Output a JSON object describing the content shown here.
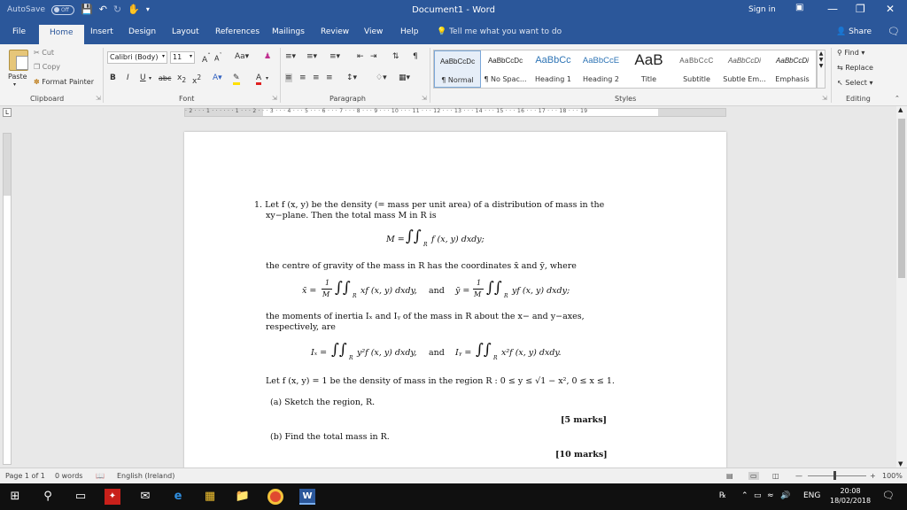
{
  "titlebar": {
    "autosave": "AutoSave",
    "toggle_state": "Off",
    "document_title": "Document1  -  Word",
    "signin": "Sign in"
  },
  "tabs": [
    "File",
    "Home",
    "Insert",
    "Design",
    "Layout",
    "References",
    "Mailings",
    "Review",
    "View",
    "Help"
  ],
  "tellme_placeholder": "Tell me what you want to do",
  "share": "Share",
  "ribbon": {
    "clipboard": {
      "paste": "Paste",
      "cut": "Cut",
      "copy": "Copy",
      "format_painter": "Format Painter",
      "label": "Clipboard"
    },
    "font": {
      "family": "Calibri (Body)",
      "size": "11",
      "label": "Font"
    },
    "paragraph": {
      "label": "Paragraph"
    },
    "styles": {
      "label": "Styles",
      "items": [
        {
          "sample": "AaBbCcDc",
          "name": "¶ Normal"
        },
        {
          "sample": "AaBbCcDc",
          "name": "¶ No Spac..."
        },
        {
          "sample": "AaBbCc",
          "name": "Heading 1"
        },
        {
          "sample": "AaBbCcE",
          "name": "Heading 2"
        },
        {
          "sample": "AaB",
          "name": "Title"
        },
        {
          "sample": "AaBbCcC",
          "name": "Subtitle"
        },
        {
          "sample": "AaBbCcDi",
          "name": "Subtle Em..."
        },
        {
          "sample": "AaBbCcDi",
          "name": "Emphasis"
        }
      ]
    },
    "editing": {
      "find": "Find",
      "replace": "Replace",
      "select": "Select",
      "label": "Editing"
    }
  },
  "ruler": {
    "corner": "L",
    "numbers": "· 2 · · · 1 · · · · · · 1 · · · 2 · · · 3 · · · 4 · · · 5 · · · 6 · · · 7 · · · 8 · · · 9 · · · 10 · · · 11 · · · 12 · · · 13 · · · 14 · · · 15 · · · 16 · · · 17 · · · 18 · · · 19"
  },
  "document": {
    "line1": "1.  Let f (x, y) be the density (= mass per unit area) of a distribution of mass in the",
    "line2": "xy−plane.  Then the total mass M in R is",
    "eq_mass_lhs": "M =",
    "eq_mass_rhs": "f (x, y) dxdy;",
    "line3": "the centre of gravity of the mass in R has the coordinates x̄ and ȳ,  where",
    "eq_cog_x_lhs": "x̄ =",
    "eq_cog_x_rhs": "xf (x, y) dxdy,",
    "eq_and": "and",
    "eq_cog_y_lhs": "ȳ =",
    "eq_cog_y_rhs": "yf (x, y) dxdy;",
    "frac_num": "1",
    "frac_den": "M",
    "subscript_R": "R",
    "line4": "the moments of inertia Iₓ and Iᵧ of the mass in R about the x− and y−axes,",
    "line5": "respectively, are",
    "eq_ix_lhs": "Iₓ =",
    "eq_ix_rhs": "y²f (x, y) dxdy,",
    "eq_iy_lhs": "Iᵧ =",
    "eq_iy_rhs": "x²f (x, y) dxdy.",
    "line6": "Let f (x, y) = 1 be the density of mass in the region R : 0 ≤ y ≤ √1 − x², 0 ≤ x ≤ 1.",
    "part_a": "(a)  Sketch the region, R.",
    "marks_a": "[5 marks]",
    "part_b": "(b)  Find the total mass in R.",
    "marks_b": "[10 marks]"
  },
  "status": {
    "page": "Page 1 of 1",
    "words": "0 words",
    "language": "English (Ireland)",
    "zoom": "100%"
  },
  "taskbar": {
    "language": "ENG",
    "time": "20:08",
    "date": "18/02/2018"
  }
}
